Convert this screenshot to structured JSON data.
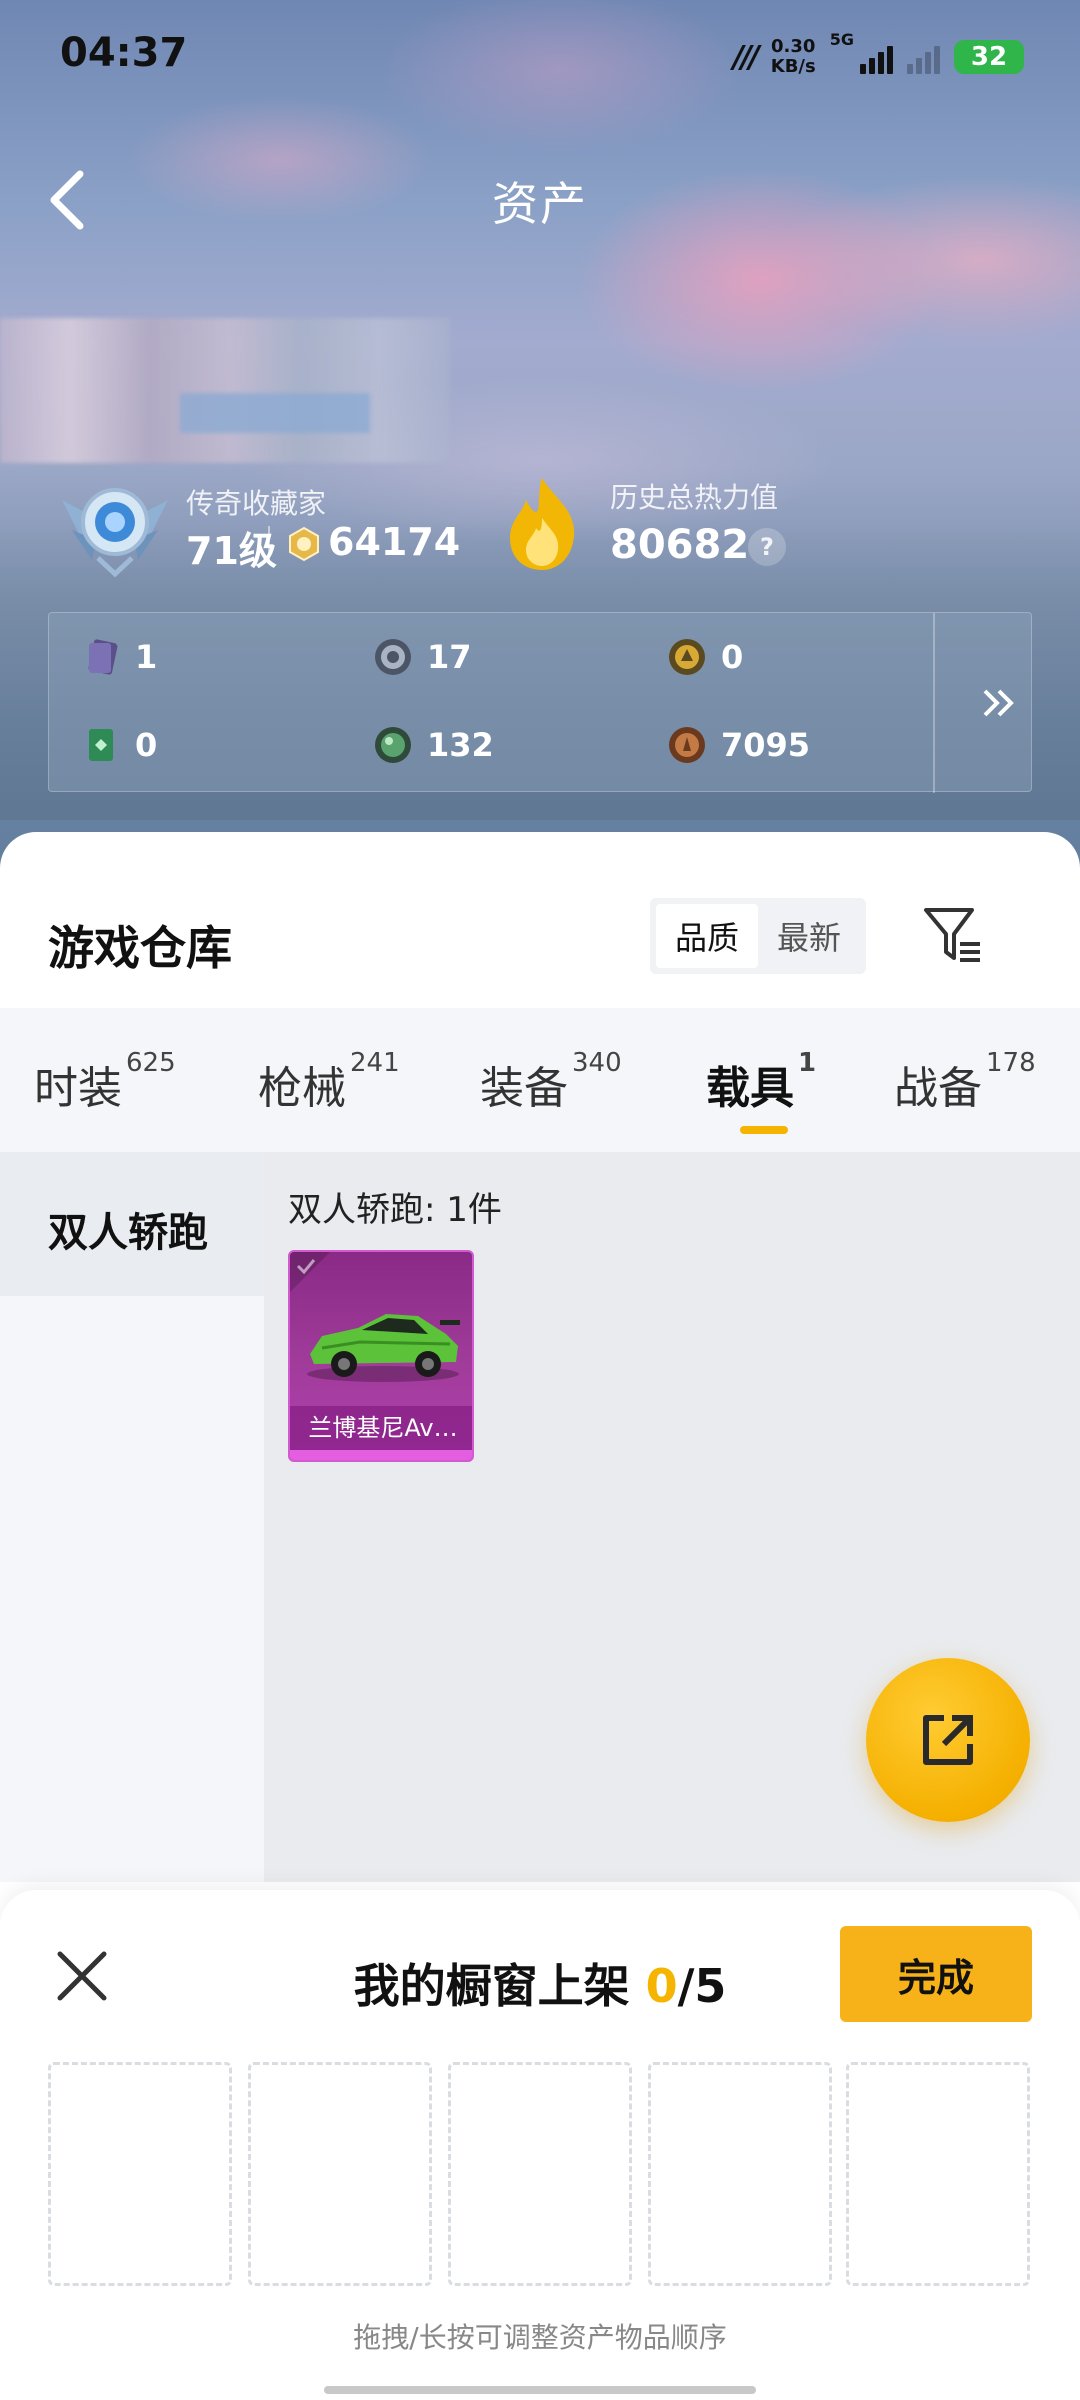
{
  "status_bar": {
    "time": "04:37",
    "net_speed_value": "0.30",
    "net_speed_unit": "KB/s",
    "network_type": "5G",
    "battery": "32"
  },
  "header": {
    "title": "资产"
  },
  "profile": {
    "rank_name": "传奇收藏家",
    "rank_level": "71级",
    "coins": "64174",
    "heat_label": "历史总热力值",
    "heat_value": "80682",
    "help": "?"
  },
  "resources": [
    {
      "icon": "purple-card-icon",
      "value": "1"
    },
    {
      "icon": "silver-badge-icon",
      "value": "17"
    },
    {
      "icon": "gold-badge-icon",
      "value": "0"
    },
    {
      "icon": "green-card-icon",
      "value": "0"
    },
    {
      "icon": "green-orb-icon",
      "value": "132"
    },
    {
      "icon": "bronze-medal-icon",
      "value": "7095"
    }
  ],
  "warehouse": {
    "title": "游戏仓库",
    "sort_options": [
      "品质",
      "最新"
    ],
    "active_sort": "品质"
  },
  "tabs": [
    {
      "label": "时装",
      "count": "625"
    },
    {
      "label": "枪械",
      "count": "241"
    },
    {
      "label": "装备",
      "count": "340"
    },
    {
      "label": "载具",
      "count": "1"
    },
    {
      "label": "战备",
      "count": "178"
    }
  ],
  "active_tab": "载具",
  "categories": [
    {
      "label": "双人轿跑"
    }
  ],
  "content": {
    "heading": "双人轿跑: 1件",
    "items": [
      {
        "name": "兰博基尼Av…"
      }
    ]
  },
  "showcase": {
    "title_prefix": "我的橱窗上架 ",
    "current": "0",
    "separator_total": "/5",
    "done_label": "完成",
    "slots": 5,
    "hint": "拖拽/长按可调整资产物品顺序"
  },
  "colors": {
    "accent": "#f5b400",
    "item_rarity": "#a13c9b"
  }
}
